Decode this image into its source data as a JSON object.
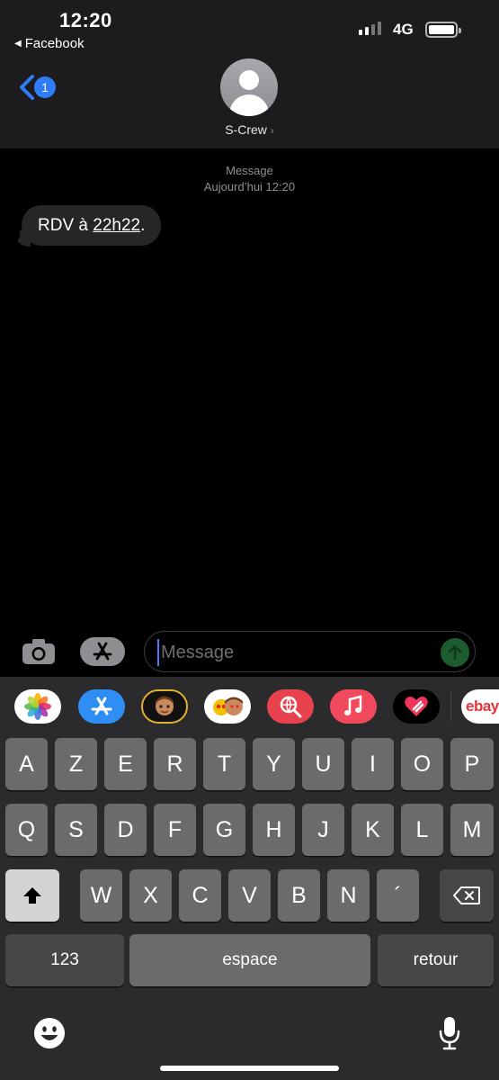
{
  "status_bar": {
    "time": "12:20",
    "back_app": "Facebook",
    "network": "4G"
  },
  "header": {
    "back_badge": "1",
    "contact_name": "S-Crew",
    "chevron": "›"
  },
  "conversation": {
    "label": "Message",
    "timestamp": "Aujourd’hui 12:20",
    "message_prefix": "RDV à ",
    "message_link": "22h22",
    "message_suffix": "."
  },
  "input": {
    "placeholder": "Message"
  },
  "app_strip": [
    "photos",
    "app-store",
    "memoji",
    "memoji-stickers",
    "search-images",
    "music",
    "digital-touch",
    "ebay"
  ],
  "app_strip_labels": {
    "ebay": "ebay"
  },
  "keyboard": {
    "row1": [
      "A",
      "Z",
      "E",
      "R",
      "T",
      "Y",
      "U",
      "I",
      "O",
      "P"
    ],
    "row2": [
      "Q",
      "S",
      "D",
      "F",
      "G",
      "H",
      "J",
      "K",
      "L",
      "M"
    ],
    "row3": [
      "W",
      "X",
      "C",
      "V",
      "B",
      "N",
      "´"
    ],
    "numbers": "123",
    "space": "espace",
    "return": "retour"
  },
  "colors": {
    "accent": "#2f7cf6",
    "send": "#1d5c2e",
    "key": "#6b6b6e",
    "key_dark": "#474749"
  }
}
